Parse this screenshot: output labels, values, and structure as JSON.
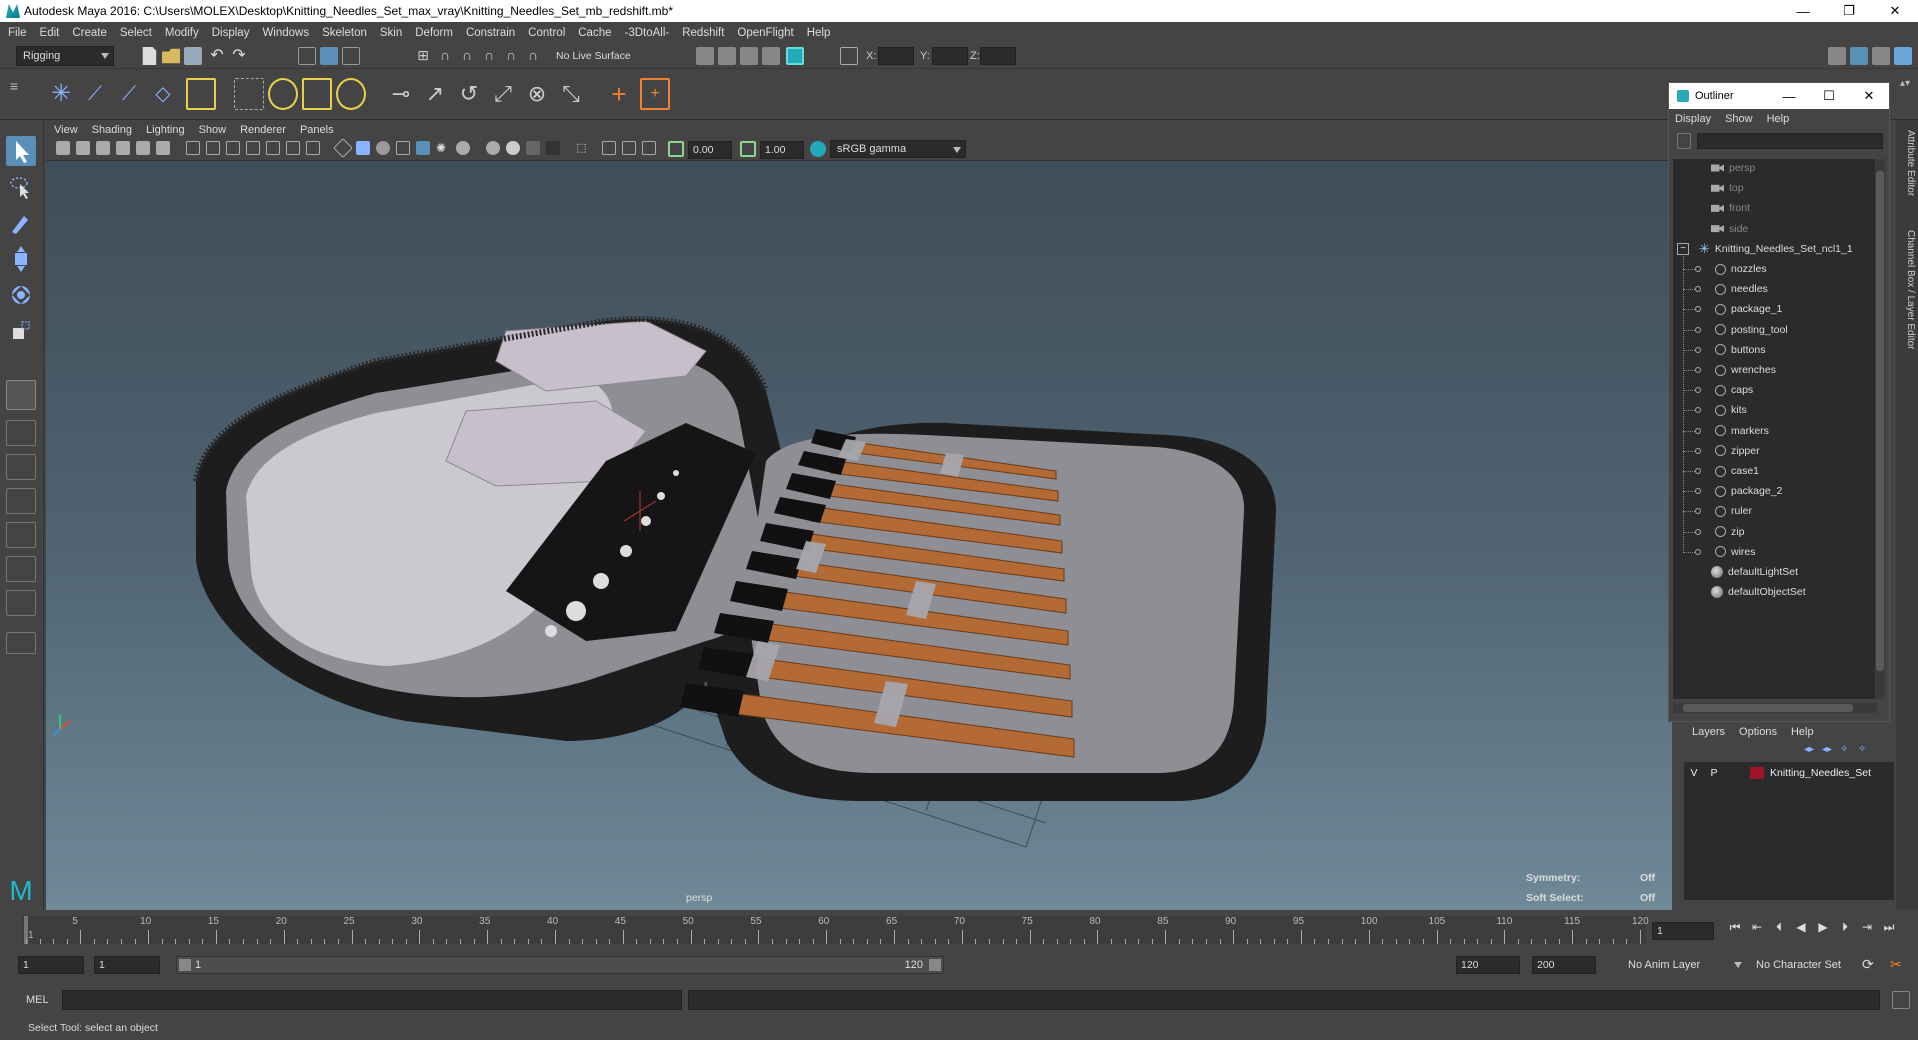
{
  "window": {
    "title": "Autodesk Maya 2016: C:\\Users\\MOLEX\\Desktop\\Knitting_Needles_Set_max_vray\\Knitting_Needles_Set_mb_redshift.mb*",
    "minimize": "—",
    "maximize": "❐",
    "close": "✕"
  },
  "menu": [
    "File",
    "Edit",
    "Create",
    "Select",
    "Modify",
    "Display",
    "Windows",
    "Skeleton",
    "Skin",
    "Deform",
    "Constrain",
    "Control",
    "Cache",
    "-3DtoAll-",
    "Redshift",
    "OpenFlight",
    "Help"
  ],
  "status": {
    "menuset": "Rigging",
    "live_surface": "No Live Surface",
    "x_label": "X:",
    "y_label": "Y:",
    "z_label": "Z:"
  },
  "viewport": {
    "menu": [
      "View",
      "Shading",
      "Lighting",
      "Show",
      "Renderer",
      "Panels"
    ],
    "near_value": "0.00",
    "far_value": "1.00",
    "color_space": "sRGB gamma",
    "camera_label": "persp",
    "symmetry_label": "Symmetry:",
    "symmetry_value": "Off",
    "soft_select_label": "Soft Select:",
    "soft_select_value": "Off"
  },
  "outliner": {
    "title": "Outliner",
    "menu": [
      "Display",
      "Show",
      "Help"
    ],
    "cameras": [
      "persp",
      "top",
      "front",
      "side"
    ],
    "root": "Knitting_Needles_Set_ncl1_1",
    "children": [
      "nozzles",
      "needles",
      "package_1",
      "posting_tool",
      "buttons",
      "wrenches",
      "caps",
      "kits",
      "markers",
      "zipper",
      "case1",
      "package_2",
      "ruler",
      "zip",
      "wires"
    ],
    "sets": [
      "defaultLightSet",
      "defaultObjectSet"
    ]
  },
  "layers": {
    "menu": [
      "Layers",
      "Options",
      "Help"
    ],
    "row": {
      "v": "V",
      "p": "P",
      "name": "Knitting_Needles_Set",
      "color": "#a0142a"
    }
  },
  "side_tabs": [
    "Attribute Editor",
    "Channel Box / Layer Editor"
  ],
  "timeline": {
    "ticks": [
      "5",
      "10",
      "15",
      "20",
      "25",
      "30",
      "35",
      "40",
      "45",
      "50",
      "55",
      "60",
      "65",
      "70",
      "75",
      "80",
      "85",
      "90",
      "95",
      "100",
      "105",
      "110",
      "115",
      "120"
    ],
    "first_label": "1",
    "current_frame": "1"
  },
  "range": {
    "start": "1",
    "playback_start": "1",
    "slider_start": "1",
    "slider_end": "120",
    "playback_end": "120",
    "end": "200",
    "anim_layer": "No Anim Layer",
    "character_set": "No Character Set"
  },
  "cmd": {
    "label": "MEL"
  },
  "help_line": "Select Tool: select an object"
}
